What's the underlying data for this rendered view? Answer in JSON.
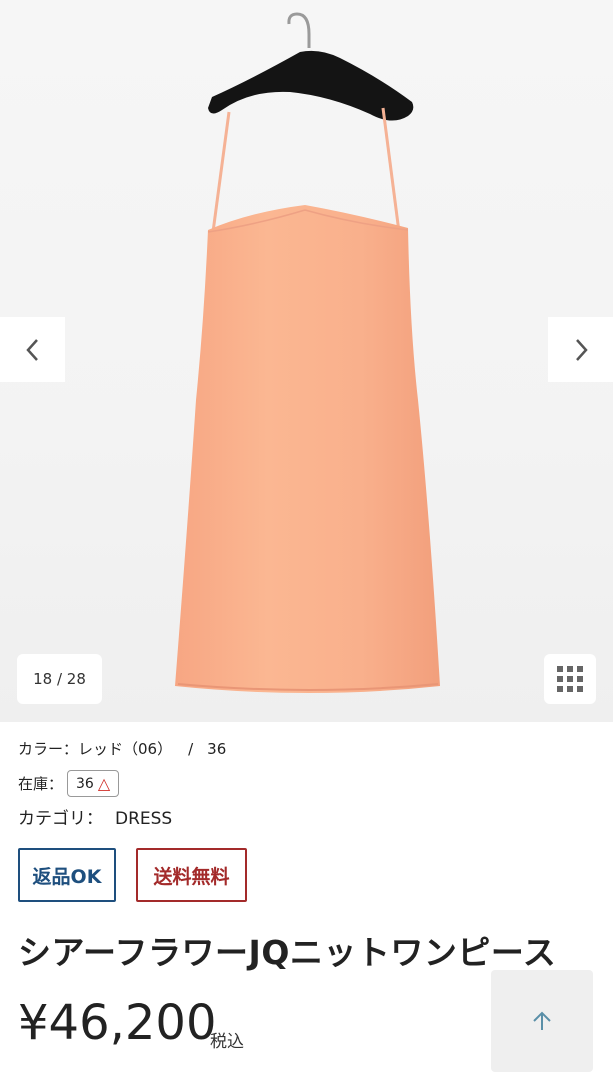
{
  "gallery": {
    "counter": "18 / 28",
    "icons": {
      "prev": "chevron-left-icon",
      "next": "chevron-right-icon",
      "grid": "grid-icon"
    }
  },
  "product": {
    "color_label": "カラー：レッド（06）",
    "separator": "/",
    "size": "36",
    "stock_label": "在庫：",
    "stock_size": "36",
    "stock_mark": "△",
    "category_label": "カテゴリ：",
    "category_value": "DRESS",
    "badges": {
      "returns": "返品OK",
      "shipping": "送料無料"
    },
    "title": "シアーフラワーJQニットワンピース",
    "price": "¥46,200",
    "tax": "税込"
  },
  "colors": {
    "dress": "#f9b08a",
    "returns_badge": "#1e4f7e",
    "shipping_badge": "#a32a2a",
    "stock_mark": "#d0302a"
  },
  "scroll_top_icon": "arrow-up-icon"
}
